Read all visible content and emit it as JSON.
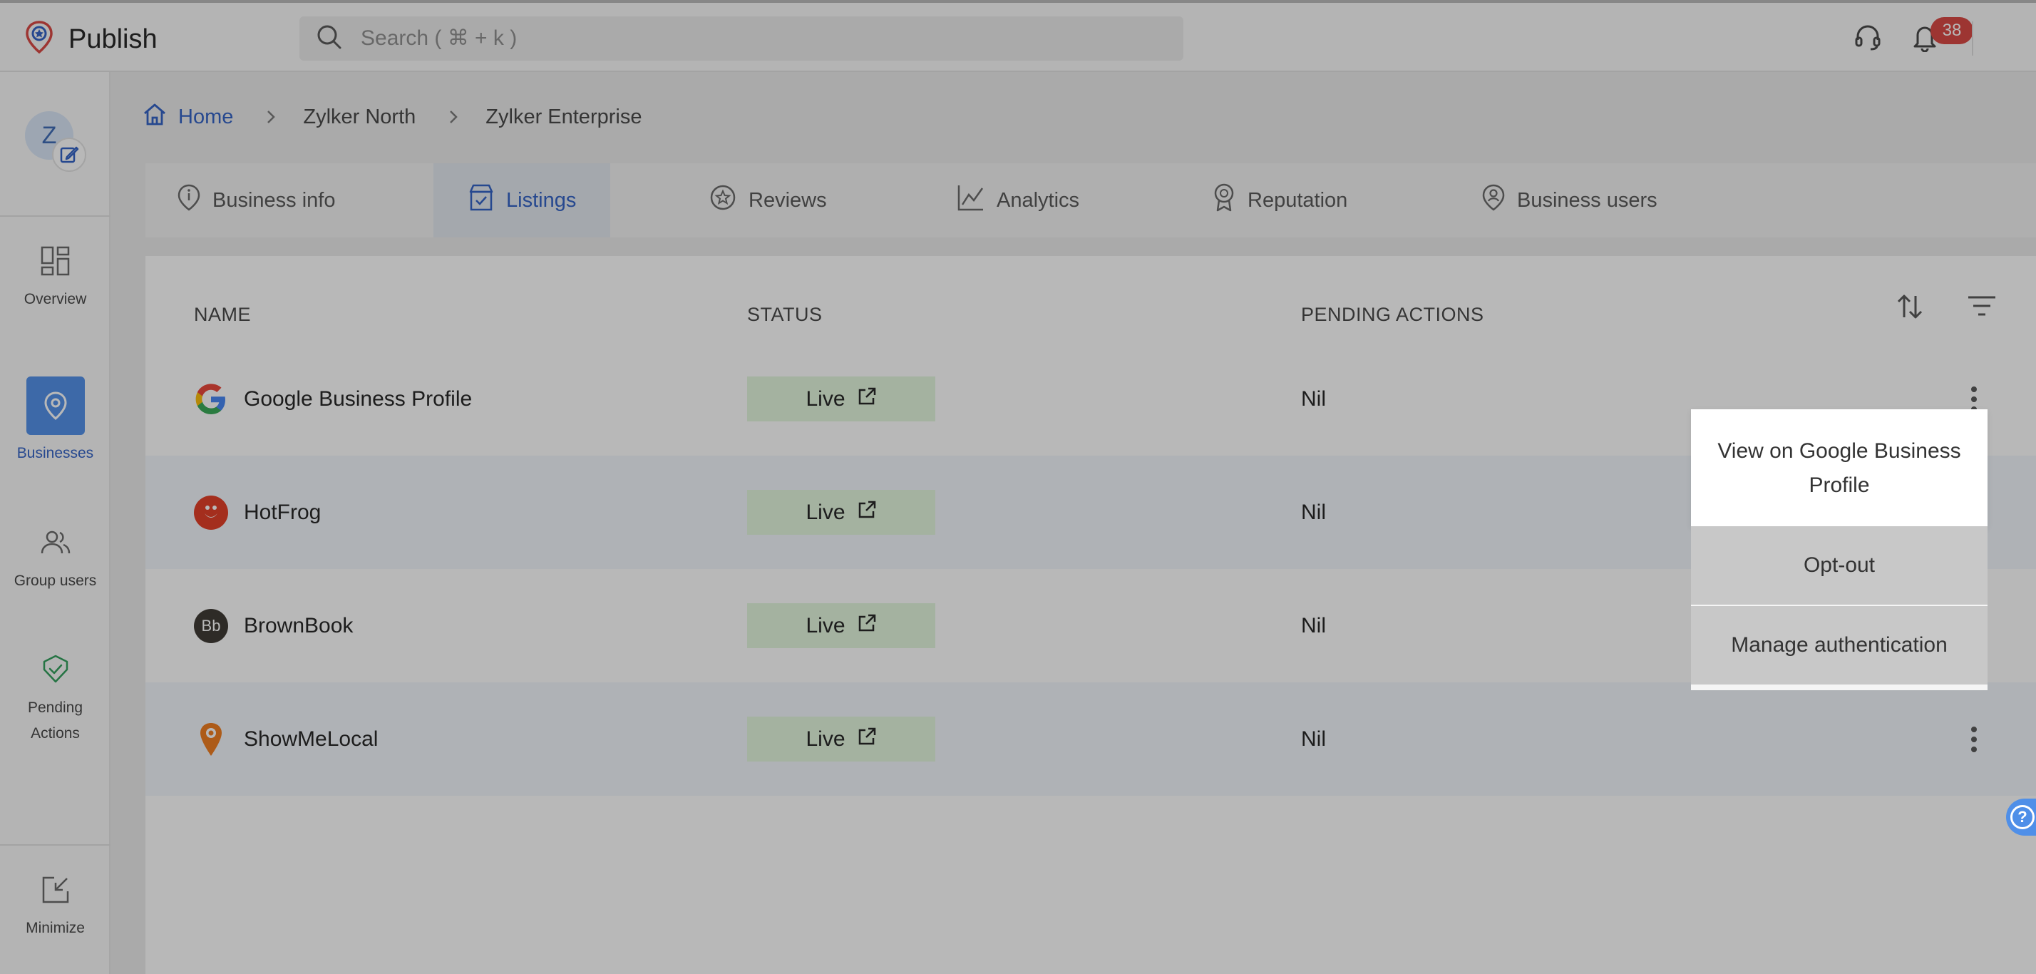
{
  "app": {
    "title": "Publish"
  },
  "search": {
    "placeholder": "Search ( ⌘ + k )"
  },
  "notifications": {
    "count": "38"
  },
  "sidebar": {
    "avatar_letter": "Z",
    "items": [
      {
        "label": "Overview"
      },
      {
        "label": "Businesses"
      },
      {
        "label": "Group users"
      },
      {
        "label": "Pending Actions"
      },
      {
        "label": "Minimize"
      }
    ]
  },
  "breadcrumb": [
    "Home",
    "Zylker North",
    "Zylker Enterprise"
  ],
  "tabs": [
    {
      "label": "Business info"
    },
    {
      "label": "Listings"
    },
    {
      "label": "Reviews"
    },
    {
      "label": "Analytics"
    },
    {
      "label": "Reputation"
    },
    {
      "label": "Business users"
    }
  ],
  "table": {
    "headers": {
      "name": "NAME",
      "status": "STATUS",
      "pending": "PENDING ACTIONS"
    },
    "rows": [
      {
        "name": "Google Business Profile",
        "status": "Live",
        "pending": "Nil",
        "logo": "google-logo"
      },
      {
        "name": "HotFrog",
        "status": "Live",
        "pending": "Nil",
        "logo": "hotfrog-logo"
      },
      {
        "name": "BrownBook",
        "status": "Live",
        "pending": "Nil",
        "logo": "brownbook-logo",
        "logo_text": "Bb"
      },
      {
        "name": "ShowMeLocal",
        "status": "Live",
        "pending": "Nil",
        "logo": "showmelocal-logo"
      }
    ]
  },
  "context_menu": {
    "items": [
      "View on Google Business Profile",
      "Opt-out",
      "Manage authentication"
    ]
  },
  "colors": {
    "accent": "#2f5fc4",
    "live_bg": "#e2f6dd",
    "badge": "#d9443f",
    "active_nav": "#4f8fe8"
  }
}
